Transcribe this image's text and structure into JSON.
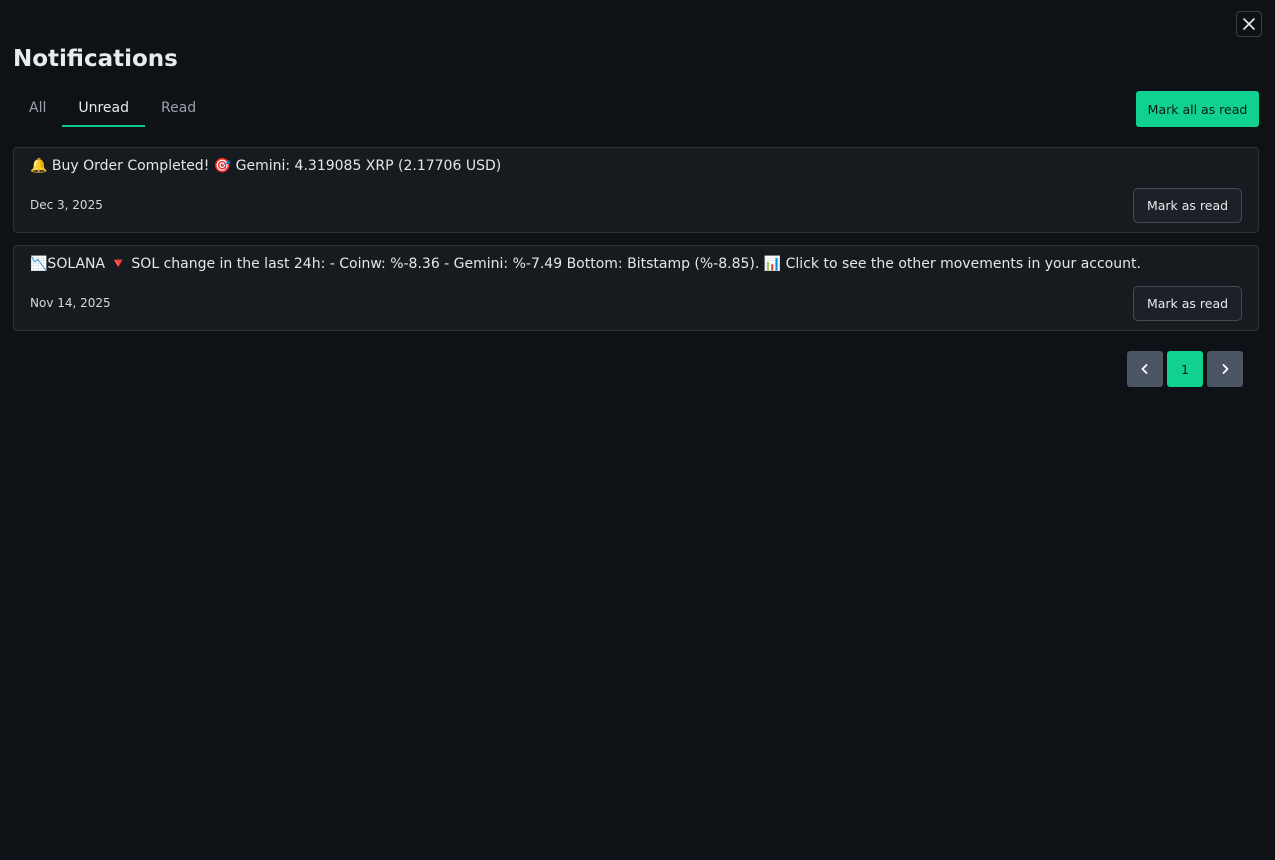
{
  "header": {
    "title": "Notifications",
    "close_icon": "close-icon"
  },
  "tabs": [
    {
      "label": "All",
      "active": false
    },
    {
      "label": "Unread",
      "active": true
    },
    {
      "label": "Read",
      "active": false
    }
  ],
  "actions": {
    "mark_all_label": "Mark all as read"
  },
  "notifications": [
    {
      "message": "🔔 Buy Order Completed! 🎯 Gemini: 4.319085 XRP (2.17706 USD)",
      "date": "Dec 3, 2025",
      "mark_label": "Mark as read"
    },
    {
      "message": "📉SOLANA 🔻 SOL change in the last 24h: - Coinw: %-8.36 - Gemini: %-7.49 Bottom: Bitstamp (%-8.85). 📊 Click to see the other movements in your account.",
      "date": "Nov 14, 2025",
      "mark_label": "Mark as read"
    }
  ],
  "pagination": {
    "current_page": "1",
    "prev_icon": "chevron-left-icon",
    "next_icon": "chevron-right-icon"
  },
  "colors": {
    "background": "#0e1216",
    "accent": "#10d18f",
    "card": "#161b20",
    "nav_button": "#4b5563"
  }
}
